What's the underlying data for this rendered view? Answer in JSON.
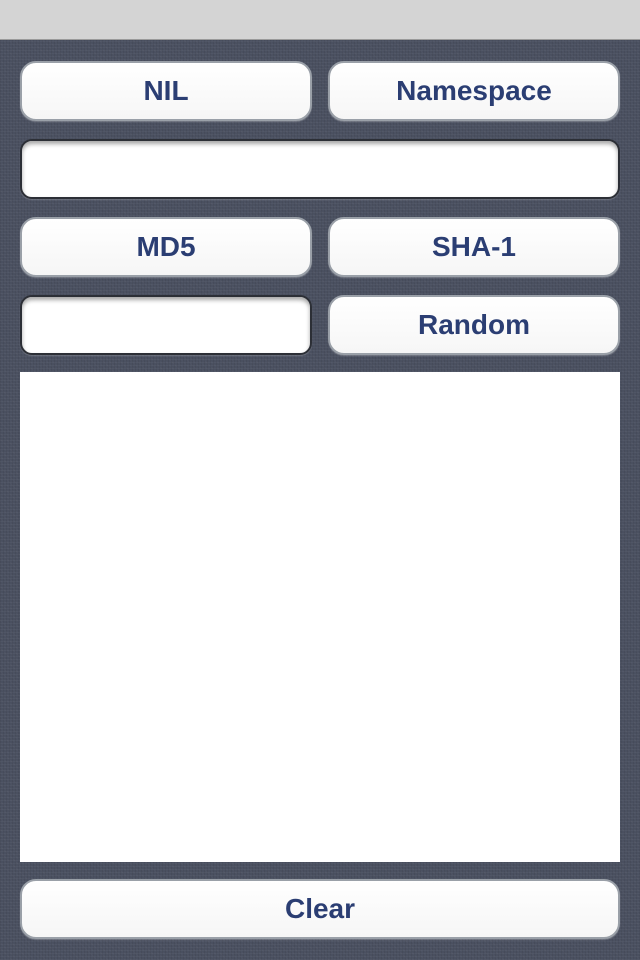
{
  "buttons": {
    "nil": "NIL",
    "namespace": "Namespace",
    "md5": "MD5",
    "sha1": "SHA-1",
    "random": "Random",
    "clear": "Clear"
  },
  "inputs": {
    "namespace_value": "",
    "name_value": ""
  },
  "output": {
    "text": ""
  },
  "colors": {
    "button_text": "#2b3e73",
    "background": "#4a5060",
    "status_bar": "#d4d4d4"
  }
}
